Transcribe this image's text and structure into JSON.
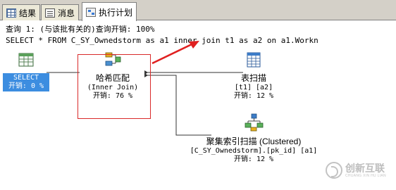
{
  "tabs": [
    {
      "label": "结果",
      "icon": "results-grid-icon",
      "active": false
    },
    {
      "label": "消息",
      "icon": "messages-icon",
      "active": false
    },
    {
      "label": "执行计划",
      "icon": "execution-plan-icon",
      "active": true
    }
  ],
  "header": {
    "query_cost": "查询 1: (与该批有关的)查询开销: 100%",
    "sql": "SELECT * FROM C_SY_Ownedstorm as a1 inner join t1 as a2 on a1.Workn"
  },
  "nodes": {
    "select": {
      "name": "SELECT",
      "cost": "开销: 0 %"
    },
    "hash_match": {
      "name": "哈希匹配",
      "detail": "(Inner Join)",
      "cost": "开销: 76 %"
    },
    "table_scan": {
      "name": "表扫描",
      "detail": "[t1] [a2]",
      "cost": "开销: 12 %"
    },
    "index_scan": {
      "name": "聚集索引扫描 (Clustered)",
      "detail": "[C_SY_Ownedstorm].[pk_id] [a1]",
      "cost": "开销: 12 %"
    }
  },
  "watermark": {
    "title": "创新互联",
    "subtitle": "CHUANG XIN HU LIAN"
  },
  "colors": {
    "selected_node": "#3c8de0",
    "annotation": "#d92a2a"
  }
}
